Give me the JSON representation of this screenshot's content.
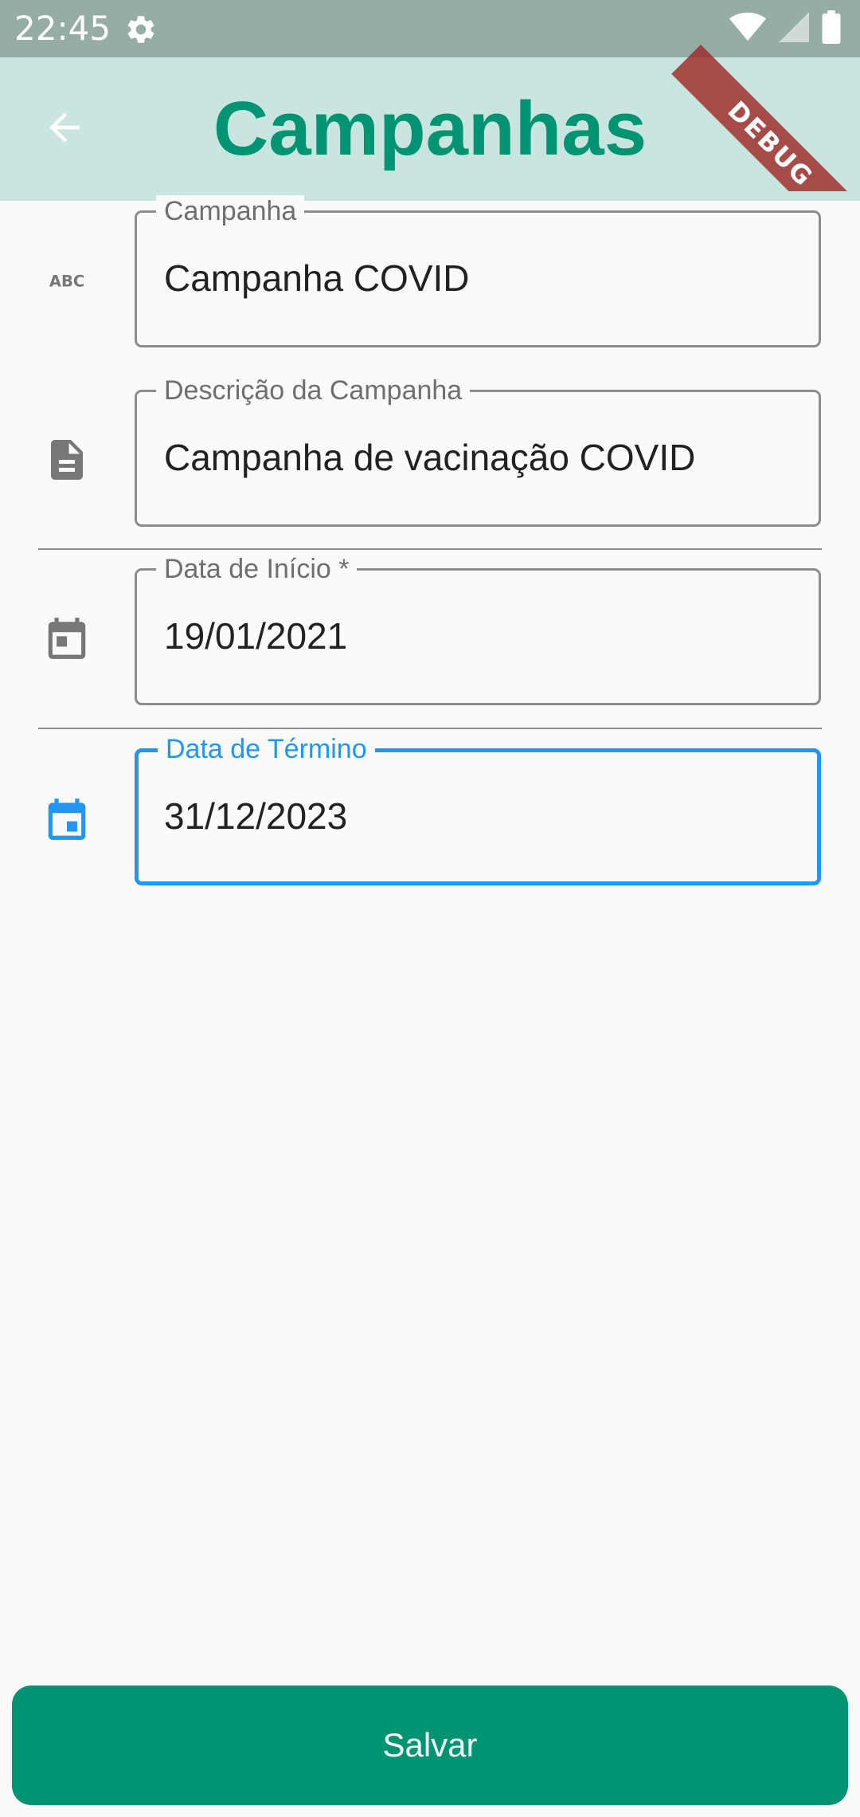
{
  "status_bar": {
    "time": "22:45",
    "icons": [
      "settings-icon",
      "wifi-icon",
      "signal-icon",
      "battery-icon"
    ]
  },
  "debug_banner": "DEBUG",
  "app_bar": {
    "title": "Campanhas",
    "back_icon": "arrow-back-icon",
    "background": "#c8e6df",
    "title_color": "#009473"
  },
  "form": {
    "fields": [
      {
        "label": "Campanha",
        "value": "Campanha COVID",
        "icon": "abc-icon",
        "focused": false
      },
      {
        "label": "Descrição da Campanha",
        "value": "Campanha de vacinação COVID",
        "icon": "description-icon",
        "focused": false
      },
      {
        "label": "Data de Início *",
        "value": "19/01/2021",
        "icon": "calendar-icon",
        "focused": false
      },
      {
        "label": "Data de Término",
        "value": "31/12/2023",
        "icon": "calendar-icon",
        "focused": true
      }
    ]
  },
  "save_button": {
    "label": "Salvar",
    "color": "#009473"
  },
  "colors": {
    "focus": "#2196f3",
    "border": "#8d8d8d",
    "icon": "#777777"
  }
}
